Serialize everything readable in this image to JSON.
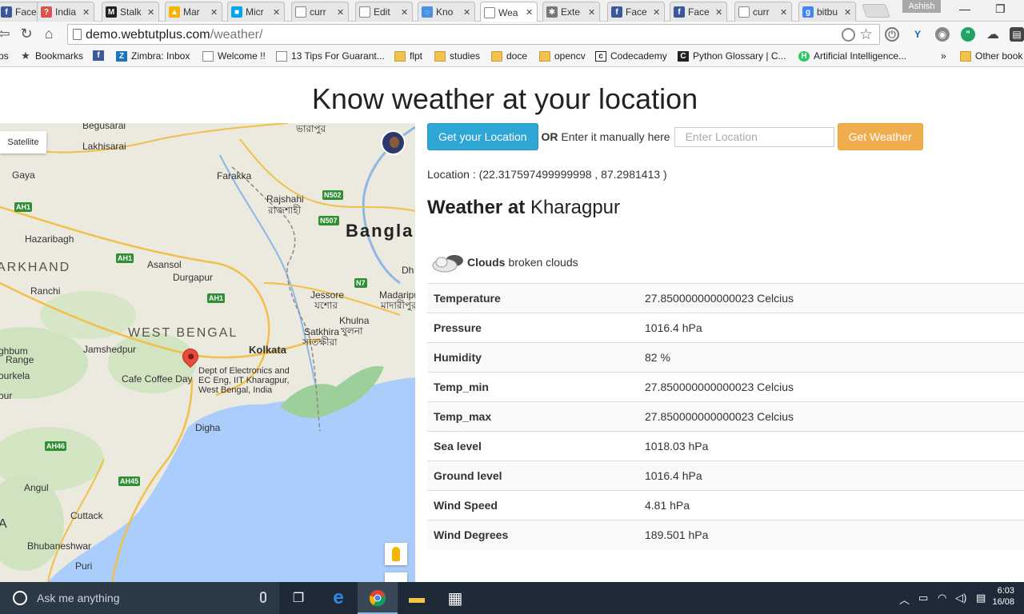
{
  "browser": {
    "tabs": [
      {
        "label": "Face",
        "favicon": "facebook-icon",
        "color": "#3b5998",
        "glyph": "f"
      },
      {
        "label": "India",
        "favicon": "vertical-page-icon",
        "color": "#d9534f",
        "glyph": "?"
      },
      {
        "label": "Stalk",
        "favicon": "medium-icon",
        "color": "#222222",
        "glyph": "M"
      },
      {
        "label": "Mar",
        "favicon": "drive-icon",
        "color": "#f4b400",
        "glyph": "▲"
      },
      {
        "label": "Micr",
        "favicon": "microsoft-icon",
        "color": "#00a4ef",
        "glyph": "■"
      },
      {
        "label": "curr",
        "favicon": "page-icon",
        "color": "#ffffff",
        "glyph": ""
      },
      {
        "label": "Edit",
        "favicon": "page-icon",
        "color": "#ffffff",
        "glyph": ""
      },
      {
        "label": "Kno",
        "favicon": "loading-icon",
        "color": "#4a90e2",
        "glyph": "◌"
      },
      {
        "label": "Wea",
        "favicon": "page-icon",
        "color": "#ffffff",
        "glyph": "",
        "active": true
      },
      {
        "label": "Exte",
        "favicon": "puzzle-icon",
        "color": "#777777",
        "glyph": "✱"
      },
      {
        "label": "Face",
        "favicon": "facebook-icon",
        "color": "#3b5998",
        "glyph": "f"
      },
      {
        "label": "Face",
        "favicon": "facebook-icon",
        "color": "#3b5998",
        "glyph": "f"
      },
      {
        "label": "curr",
        "favicon": "page-icon",
        "color": "#ffffff",
        "glyph": ""
      },
      {
        "label": "bitbu",
        "favicon": "google-icon",
        "color": "#4285f4",
        "glyph": "g"
      }
    ],
    "profile": "Ashish",
    "url_host": "demo.webtutplus.com",
    "url_path": "/weather/",
    "bookmarks": [
      {
        "label": "ps",
        "icon": "apps-icon",
        "kind": "none"
      },
      {
        "label": "Bookmarks",
        "icon": "star-icon",
        "kind": "star"
      },
      {
        "label": "",
        "icon": "facebook-icon",
        "kind": "fb"
      },
      {
        "label": "Zimbra: Inbox",
        "icon": "zimbra-icon",
        "kind": "z"
      },
      {
        "label": "Welcome !!",
        "icon": "page-icon",
        "kind": "doc"
      },
      {
        "label": "13 Tips For Guarant...",
        "icon": "page-icon",
        "kind": "doc"
      },
      {
        "label": "flpt",
        "icon": "folder-icon",
        "kind": "folder"
      },
      {
        "label": "studies",
        "icon": "folder-icon",
        "kind": "folder"
      },
      {
        "label": "doce",
        "icon": "folder-icon",
        "kind": "folder"
      },
      {
        "label": "opencv",
        "icon": "folder-icon",
        "kind": "folder"
      },
      {
        "label": "Codecademy",
        "icon": "codecademy-icon",
        "kind": "cc"
      },
      {
        "label": "Python Glossary | C...",
        "icon": "codecademy-c-icon",
        "kind": "c"
      },
      {
        "label": "Artificial Intelligence...",
        "icon": "hackerrank-icon",
        "kind": "h"
      },
      {
        "label": "»",
        "icon": "overflow-icon",
        "kind": "none"
      },
      {
        "label": "Other book",
        "icon": "folder-icon",
        "kind": "folder"
      }
    ]
  },
  "page": {
    "title": "Know weather at your location",
    "get_location_label": "Get your Location",
    "or_label": "OR",
    "manual_label": "Enter it manually here",
    "location_placeholder": "Enter Location",
    "get_weather_label": "Get Weather",
    "location_text": "Location : (22.317597499999998 , 87.2981413 )",
    "weather_at_label": "Weather at",
    "city": "Kharagpur",
    "condition_main": "Clouds",
    "condition_desc": "broken clouds",
    "rows": [
      {
        "key": "Temperature",
        "value": "27.850000000000023 Celcius"
      },
      {
        "key": "Pressure",
        "value": "1016.4 hPa"
      },
      {
        "key": "Humidity",
        "value": "82 %"
      },
      {
        "key": "Temp_min",
        "value": "27.850000000000023 Celcius"
      },
      {
        "key": "Temp_max",
        "value": "27.850000000000023 Celcius"
      },
      {
        "key": "Sea level",
        "value": "1018.03 hPa"
      },
      {
        "key": "Ground level",
        "value": "1016.4 hPa"
      },
      {
        "key": "Wind Speed",
        "value": "4.81 hPa"
      },
      {
        "key": "Wind Degrees",
        "value": "189.501 hPa"
      }
    ]
  },
  "map": {
    "satellite_label": "Satellite",
    "marker_label": "Dept of Electronics and\nEC Eng, IIT Kharagpur,\nWest Bengal, India",
    "country_label": "Bangla",
    "regions": [
      "ARKHAND",
      "WEST BENGAL"
    ],
    "places": [
      "Begusarai",
      "Lakhisarai",
      "Gaya",
      "Farakka",
      "Rajshahi",
      "রাজশাহী",
      "Hazaribagh",
      "Asansol",
      "Durgapur",
      "Ranchi",
      "Jessore",
      "যশোর",
      "Madaripur",
      "মাদারীপুর",
      "Khulna",
      "খুলনা",
      "Satkhira",
      "সাতক্ষীরা",
      "Jamshedpur",
      "Kolkata",
      "Cafe Coffee Day",
      "ghbum",
      "Range",
      "ourkela",
      "pur",
      "Digha",
      "Angul",
      "Cuttack",
      "Bhubaneshwar",
      "Puri",
      "A",
      "Dh",
      "ভারাপুর"
    ],
    "highways": [
      "AH1",
      "N502",
      "N507",
      "AH1",
      "AH1",
      "N7",
      "AH46",
      "AH45"
    ]
  },
  "taskbar": {
    "search_placeholder": "Ask me anything",
    "time": "6:03",
    "date": "16/08"
  },
  "colors": {
    "accent_blue": "#2fa7d6",
    "accent_orange": "#f0ad4e",
    "map_land": "#ece9df",
    "map_water": "#abcdfb"
  }
}
